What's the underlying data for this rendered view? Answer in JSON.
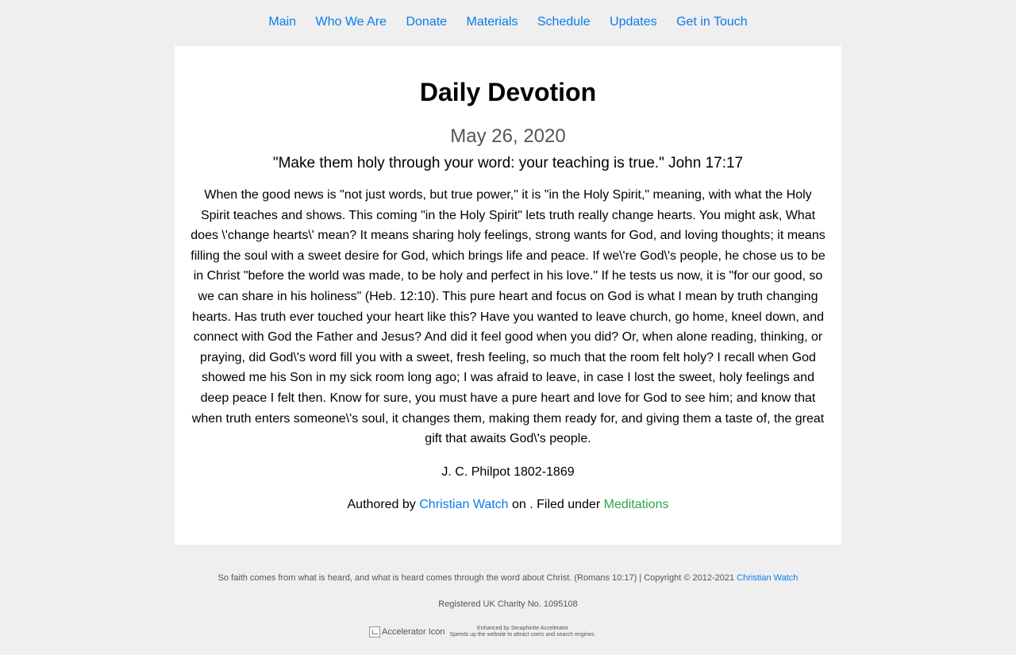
{
  "nav": {
    "items": [
      "Main",
      "Who We Are",
      "Donate",
      "Materials",
      "Schedule",
      "Updates",
      "Get in Touch"
    ]
  },
  "article": {
    "title": "Daily Devotion",
    "date": "May 26, 2020",
    "verse": "\"Make them holy through your word: your teaching is true.\" John 17:17",
    "body": "When the good news is \"not just words, but true power,\" it is \"in the Holy Spirit,\" meaning, with what the Holy Spirit teaches and shows. This coming \"in the Holy Spirit\" lets truth really change hearts. You might ask, What does \\'change hearts\\' mean? It means sharing holy feelings, strong wants for God, and loving thoughts; it means filling the soul with a sweet desire for God, which brings life and peace. If we\\'re God\\'s people, he chose us to be in Christ \"before the world was made, to be holy and perfect in his love.\" If he tests us now, it is \"for our good, so we can share in his holiness\" (Heb. 12:10). This pure heart and focus on God is what I mean by truth changing hearts. Has truth ever touched your heart like this? Have you wanted to leave church, go home, kneel down, and connect with God the Father and Jesus? And did it feel good when you did? Or, when alone reading, thinking, or praying, did God\\'s word fill you with a sweet, fresh feeling, so much that the room felt holy? I recall when God showed me his Son in my sick room long ago; I was afraid to leave, in case I lost the sweet, holy feelings and deep peace I felt then. Know for sure, you must have a pure heart and love for God to see him; and know that when truth enters someone\\'s soul, it changes them, making them ready for, and giving them a taste of, the great gift that awaits God\\'s people.",
    "attribution": "J. C. Philpot 1802-1869",
    "meta": {
      "authored_by_text": "Authored by",
      "author_link": "Christian Watch",
      "on_text": "on . Filed under",
      "category_link": "Meditations"
    }
  },
  "footer": {
    "scripture_text": "So faith comes from what is heard, and what is heard comes through the word about Christ. (Romans 10:17) | Copyright © 2012-2021",
    "copyright_link": "Christian Watch",
    "charity": "Registered UK Charity No. 1095108",
    "accelerator": {
      "icon_alt": "Accelerator Icon",
      "line1": "Enhanced by Seraphinite Accelerator",
      "line2": "Speeds up the website to attract users and search engines."
    }
  },
  "colors": {
    "link_blue": "#0b7bea",
    "link_green": "#2ea44f",
    "background": "#efefef",
    "card": "#ffffff",
    "muted_text": "#555555"
  }
}
